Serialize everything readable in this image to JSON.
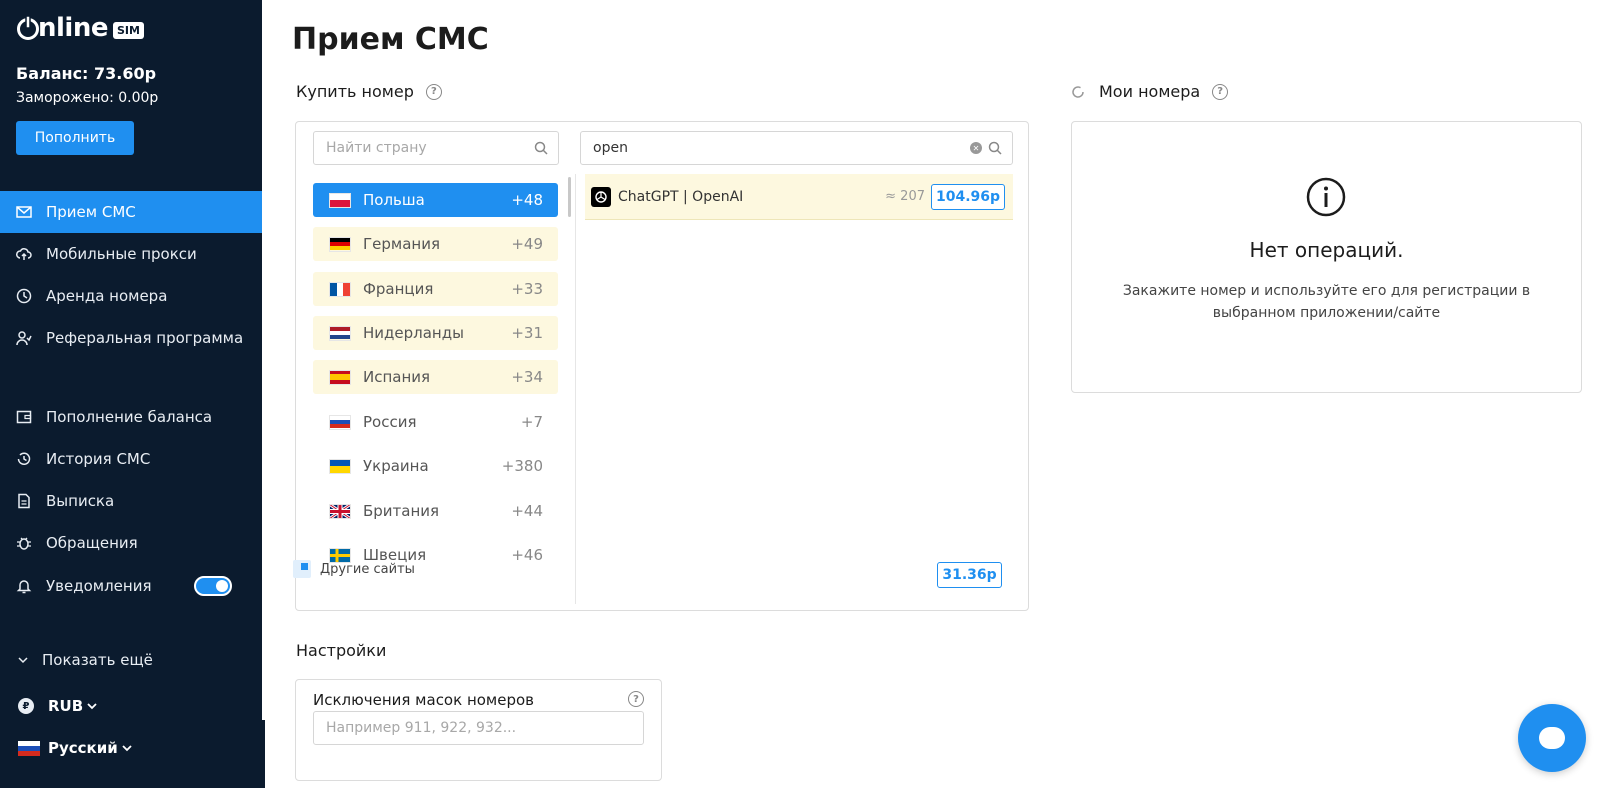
{
  "sidebar": {
    "logo_text": "nline",
    "logo_badge": "SIM",
    "balance": "Баланс: 73.60р",
    "frozen": "Заморожено: 0.00р",
    "topup_label": "Пополнить",
    "nav_main": [
      {
        "label": "Прием СМС",
        "icon": "mail-icon",
        "active": true
      },
      {
        "label": "Мобильные прокси",
        "icon": "cloud-upload-icon"
      },
      {
        "label": "Аренда номера",
        "icon": "clock-icon"
      },
      {
        "label": "Реферальная программа",
        "icon": "users-icon"
      }
    ],
    "nav_secondary": [
      {
        "label": "Пополнение баланса",
        "icon": "wallet-icon"
      },
      {
        "label": "История СМС",
        "icon": "history-icon"
      },
      {
        "label": "Выписка",
        "icon": "document-icon"
      },
      {
        "label": "Обращения",
        "icon": "bug-icon"
      },
      {
        "label": "Уведомления",
        "icon": "bell-icon",
        "toggle": true
      }
    ],
    "show_more": "Показать ещё",
    "currency": "RUB",
    "currency_symbol": "₽",
    "language": "Русский"
  },
  "main": {
    "title": "Прием СМС",
    "buy_title": "Купить номер",
    "country_search_placeholder": "Найти страну",
    "service_search_value": "open",
    "countries": [
      {
        "name": "Польша",
        "code": "+48",
        "state": "active"
      },
      {
        "name": "Германия",
        "code": "+49",
        "state": "highlight"
      },
      {
        "name": "Франция",
        "code": "+33",
        "state": "highlight"
      },
      {
        "name": "Нидерланды",
        "code": "+31",
        "state": "highlight"
      },
      {
        "name": "Испания",
        "code": "+34",
        "state": "highlight"
      },
      {
        "name": "Россия",
        "code": "+7",
        "state": "normal"
      },
      {
        "name": "Украина",
        "code": "+380",
        "state": "normal"
      },
      {
        "name": "Британия",
        "code": "+44",
        "state": "normal"
      },
      {
        "name": "Швеция",
        "code": "+46",
        "state": "normal"
      }
    ],
    "service": {
      "name": "ChatGPT | OpenAI",
      "count": "≈ 207",
      "price": "104.96р"
    },
    "other_sites": {
      "label": "Другие сайты",
      "price": "31.36р"
    },
    "my_numbers_title": "Мои номера",
    "empty_title": "Нет операций.",
    "empty_text": "Закажите номер и используйте его для регистрации в выбранном приложении/сайте",
    "settings_title": "Настройки",
    "masks_label": "Исключения масок номеров",
    "masks_placeholder": "Например 911, 922, 932..."
  },
  "colors": {
    "accent": "#1f8ff0",
    "sidebar": "#0b1b2e",
    "highlight": "#fdf8df"
  }
}
